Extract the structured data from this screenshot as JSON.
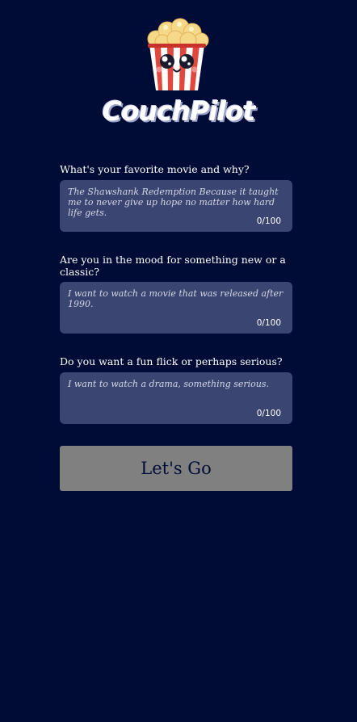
{
  "app": {
    "title": "CouchPilot"
  },
  "questions": [
    {
      "label": "What's your favorite movie and why?",
      "value": "The Shawshank Redemption Because it taught me to never give up hope no matter how hard life gets.",
      "counter": "0/100"
    },
    {
      "label": "Are you in the mood for something new or a classic?",
      "value": "I want to watch a movie that was released after 1990.",
      "counter": "0/100"
    },
    {
      "label": "Do you want a fun flick or perhaps serious?",
      "value": "I want to watch a drama, something serious.",
      "counter": "0/100"
    }
  ],
  "submit": {
    "label": "Let's Go"
  },
  "colors": {
    "background": "#000c36",
    "field": "#3b4571",
    "button": "#808080",
    "button_text": "#000c36"
  },
  "icons": {
    "logo": "popcorn-mascot-icon"
  }
}
